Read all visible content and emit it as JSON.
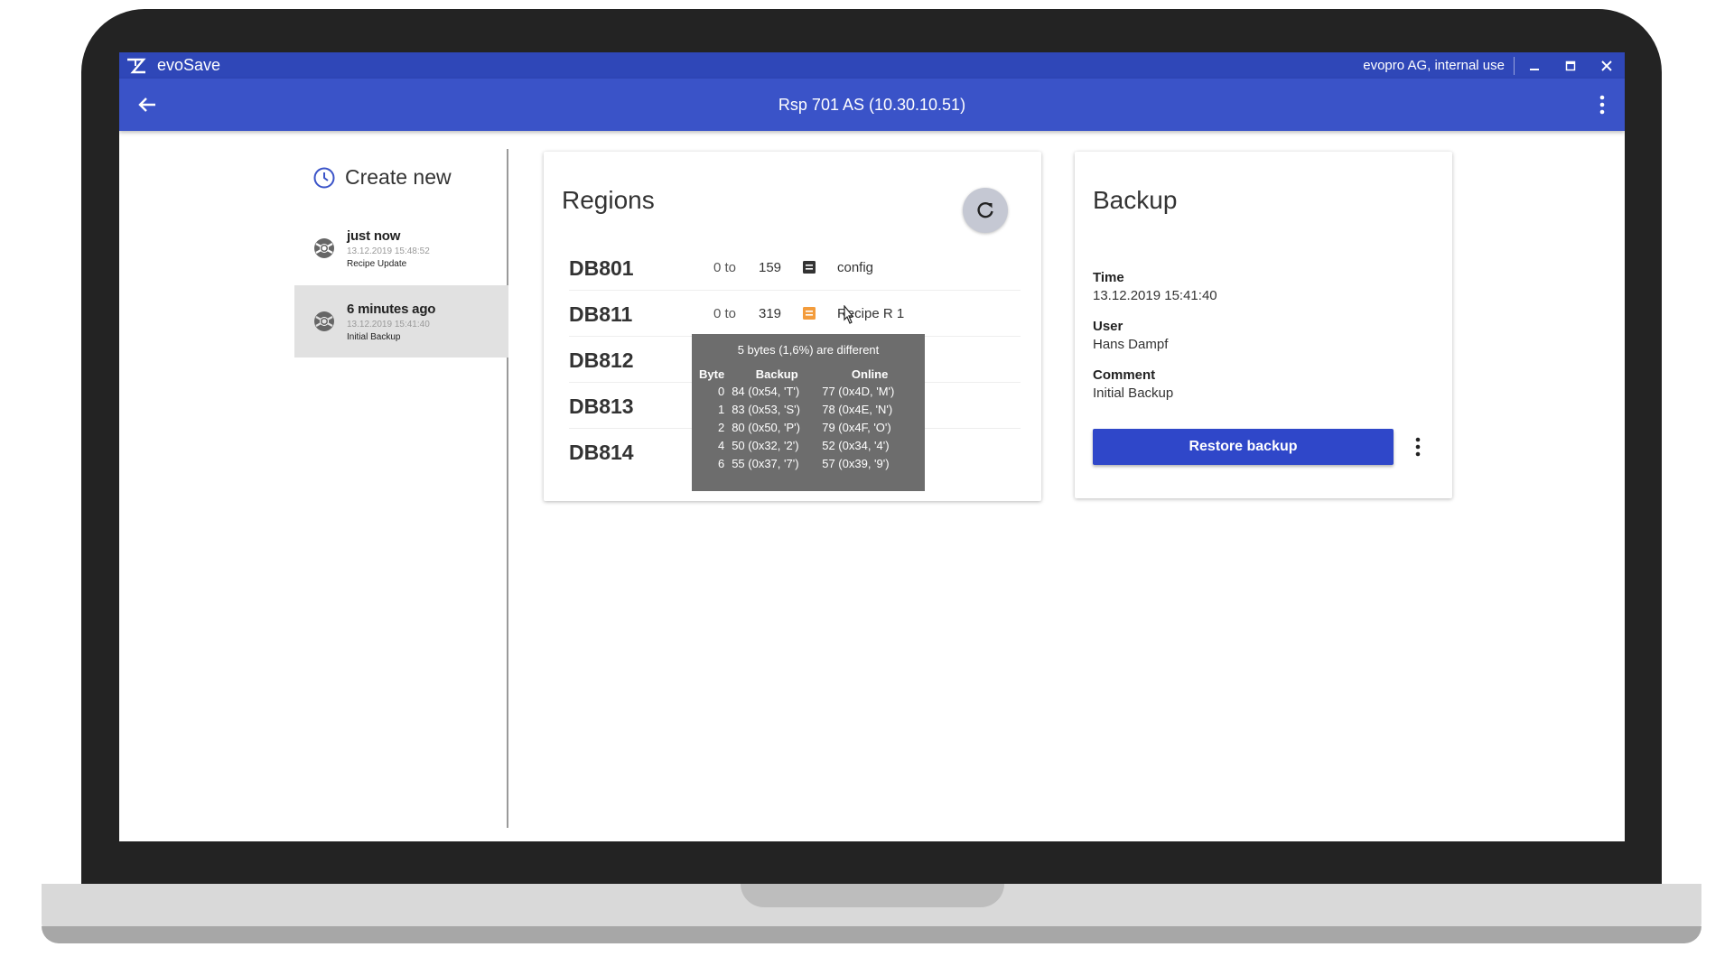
{
  "window": {
    "app_name": "evoSave",
    "company": "evopro AG, internal use"
  },
  "appbar": {
    "title": "Rsp 701 AS (10.30.10.51)"
  },
  "sidebar": {
    "create_new": "Create new",
    "items": [
      {
        "title": "just now",
        "time": "13.12.2019 15:48:52",
        "desc": "Recipe Update",
        "selected": false
      },
      {
        "title": "6 minutes ago",
        "time": "13.12.2019 15:41:40",
        "desc": "Initial Backup",
        "selected": true
      }
    ]
  },
  "regions": {
    "title": "Regions",
    "rows": [
      {
        "name": "DB801",
        "from": "0 to",
        "to": "159",
        "icon": "document-icon",
        "label": "config"
      },
      {
        "name": "DB811",
        "from": "0 to",
        "to": "319",
        "icon": "warning-document-icon",
        "label": "Recipe R 1"
      },
      {
        "name": "DB812"
      },
      {
        "name": "DB813"
      },
      {
        "name": "DB814"
      }
    ]
  },
  "tooltip": {
    "title": "5 bytes (1,6%) are different",
    "headers": {
      "byte": "Byte",
      "backup": "Backup",
      "online": "Online"
    },
    "rows": [
      {
        "byte": "0",
        "backup": "84 (0x54, 'T')",
        "online": "77 (0x4D, 'M')"
      },
      {
        "byte": "1",
        "backup": "83 (0x53, 'S')",
        "online": "78 (0x4E, 'N')"
      },
      {
        "byte": "2",
        "backup": "80 (0x50, 'P')",
        "online": "79 (0x4F, 'O')"
      },
      {
        "byte": "4",
        "backup": "50 (0x32, '2')",
        "online": "52 (0x34, '4')"
      },
      {
        "byte": "6",
        "backup": "55 (0x37, '7')",
        "online": "57 (0x39, '9')"
      }
    ]
  },
  "backup": {
    "title": "Backup",
    "time_label": "Time",
    "time_value": "13.12.2019 15:41:40",
    "user_label": "User",
    "user_value": "Hans Dampf",
    "comment_label": "Comment",
    "comment_value": "Initial Backup",
    "restore_label": "Restore backup"
  },
  "colors": {
    "titlebar": "#2f47b8",
    "appbar": "#3a53c8",
    "primary_button": "#2f47c9",
    "warning": "#f39c3c"
  }
}
